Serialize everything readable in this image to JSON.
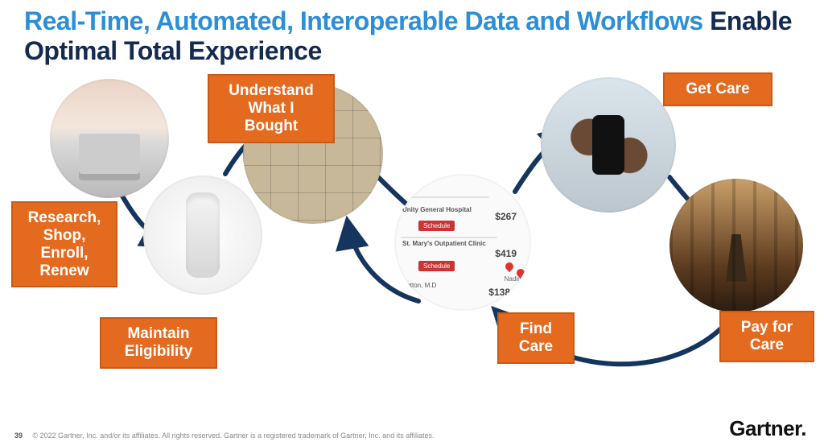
{
  "title": {
    "highlight": "Real-Time, Automated, Interoperable Data and Workflows ",
    "rest": "Enable Optimal Total Experience"
  },
  "steps": [
    {
      "id": "research",
      "label": "Research,\nShop,\nEnroll,\nRenew",
      "image": "person-with-laptop"
    },
    {
      "id": "eligibility",
      "label": "Maintain\nEligibility",
      "image": "smart-speaker"
    },
    {
      "id": "understand",
      "label": "Understand\nWhat I\nBought",
      "image": "puzzle-pieces"
    },
    {
      "id": "find",
      "label": "Find\nCare",
      "image": "care-map-prices"
    },
    {
      "id": "get",
      "label": "Get Care",
      "image": "hands-holding-phone"
    },
    {
      "id": "pay",
      "label": "Pay for\nCare",
      "image": "person-meditating-sunset"
    }
  ],
  "map_panel": {
    "facilities": [
      {
        "name": "Unity General Hospital",
        "price": "$267",
        "action": "Schedule"
      },
      {
        "name": "St. Mary's Outpatient Clinic",
        "price": "$419",
        "action": "Schedule"
      },
      {
        "name": "Setton, M.D",
        "price": "$138"
      }
    ],
    "caption": "Nadine Eccleston, M"
  },
  "footer": {
    "page": "39",
    "copyright": "© 2022 Gartner, Inc. and/or its affiliates. All rights reserved. Gartner is a registered trademark of Gartner, Inc. and its affiliates."
  },
  "brand": "Gartner",
  "colors": {
    "accent": "#e46a1f",
    "title_highlight": "#2b8ed6",
    "title_dark": "#142a4f",
    "arrow": "#15355e"
  }
}
